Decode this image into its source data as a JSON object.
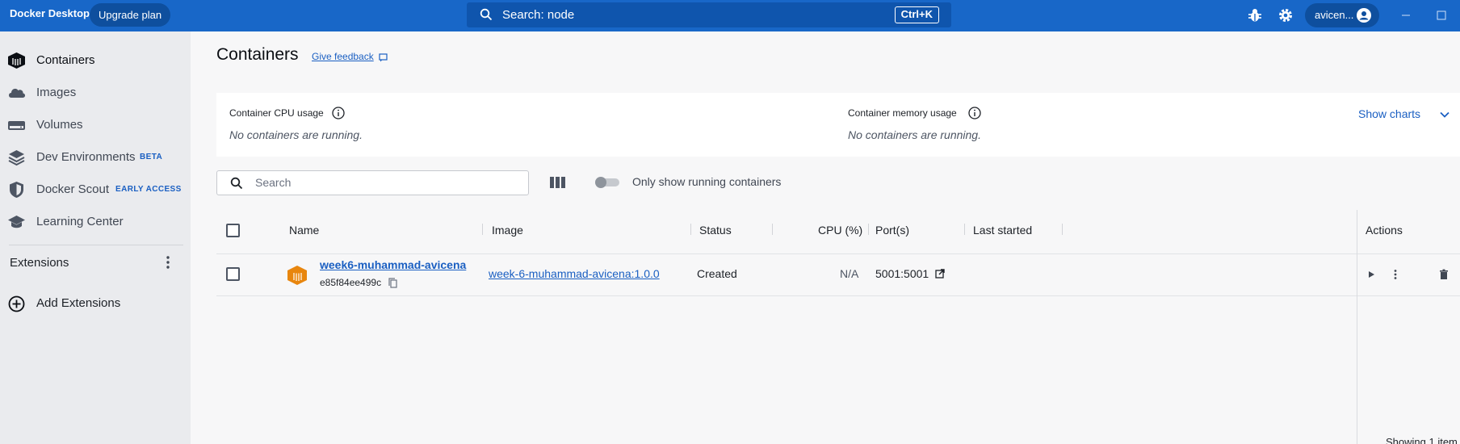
{
  "titlebar": {
    "app_name": "Docker Desktop",
    "upgrade_label": "Upgrade plan",
    "search_text": "Search: node",
    "shortcut": "Ctrl+K",
    "account_name": "avicen..."
  },
  "sidebar": {
    "items": [
      {
        "label": "Containers",
        "icon": "containers-icon",
        "active": true
      },
      {
        "label": "Images",
        "icon": "images-cloud-icon"
      },
      {
        "label": "Volumes",
        "icon": "volumes-icon"
      },
      {
        "label": "Dev Environments",
        "icon": "dev-environments-icon",
        "badge": "BETA"
      },
      {
        "label": "Docker Scout",
        "icon": "shield-icon",
        "badge": "EARLY ACCESS"
      },
      {
        "label": "Learning Center",
        "icon": "graduation-cap-icon"
      }
    ],
    "extensions_label": "Extensions",
    "add_extensions_label": "Add Extensions"
  },
  "main": {
    "title": "Containers",
    "feedback_label": "Give feedback",
    "stats": {
      "cpu_title": "Container CPU usage",
      "cpu_sub": "No containers are running.",
      "mem_title": "Container memory usage",
      "mem_sub": "No containers are running.",
      "show_charts": "Show charts"
    },
    "search_placeholder": "Search",
    "toggle_label": "Only show running containers",
    "table": {
      "columns": [
        "Name",
        "Image",
        "Status",
        "CPU (%)",
        "Port(s)",
        "Last started",
        "Actions"
      ],
      "rows": [
        {
          "name": "week6-muhammad-avicena",
          "id": "e85f84ee499c",
          "image": "week-6-muhammad-avicena:1.0.0",
          "status": "Created",
          "cpu": "N/A",
          "ports": "5001:5001",
          "last_started": ""
        }
      ]
    },
    "footer": "Showing 1 item"
  },
  "colors": {
    "titlebar": "#1867c8",
    "accent": "#1a5fc2",
    "container_icon": "#e8860e"
  }
}
